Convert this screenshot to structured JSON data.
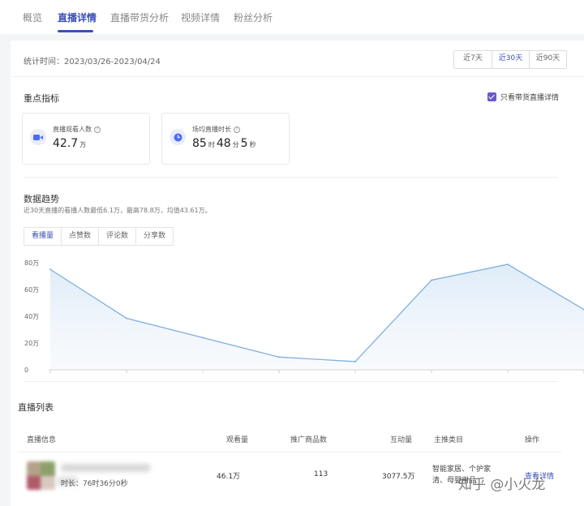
{
  "tabs": [
    {
      "label": "概览",
      "active": false
    },
    {
      "label": "直播详情",
      "active": true
    },
    {
      "label": "直播带货分析",
      "active": false
    },
    {
      "label": "视频详情",
      "active": false
    },
    {
      "label": "粉丝分析",
      "active": false
    }
  ],
  "period": "统计时间：2023/03/26-2023/04/24",
  "range_buttons": [
    {
      "label": "近7天",
      "active": false
    },
    {
      "label": "近30天",
      "active": true
    },
    {
      "label": "近90天",
      "active": false
    }
  ],
  "key_metrics": {
    "title": "重点指标",
    "checkbox_label": "只看带货直播详情",
    "checkbox_checked": true,
    "viewers": {
      "label": "直播观看人数",
      "value": "42.7",
      "unit": "万"
    },
    "duration": {
      "label": "场均直播时长",
      "h": "85",
      "h_unit": "时",
      "m": "48",
      "m_unit": "分",
      "s": "5",
      "s_unit": "秒"
    }
  },
  "trend": {
    "title": "数据趋势",
    "desc": "近30天直播的看播人数最低6.1万，最高78.8万，均值43.61万。",
    "tabs": [
      {
        "label": "看播量",
        "active": true
      },
      {
        "label": "点赞数",
        "active": false
      },
      {
        "label": "评论数",
        "active": false
      },
      {
        "label": "分享数",
        "active": false
      }
    ]
  },
  "chart_data": {
    "type": "area",
    "y_ticks": [
      "0",
      "20万",
      "40万",
      "60万",
      "80万"
    ],
    "ylim": [
      0,
      80
    ],
    "series": [
      {
        "values": [
          75,
          38.5,
          24,
          9.5,
          6.1,
          67,
          78.8,
          45
        ]
      }
    ],
    "grid": false
  },
  "live_list": {
    "title": "直播列表",
    "headers": [
      "直播信息",
      "观看量",
      "推广商品数",
      "互动量",
      "主推类目",
      "操作"
    ],
    "rows": [
      {
        "duration": "时长：76时36分0秒",
        "views": "46.1万",
        "products": "113",
        "interactions": "3077.5万",
        "categories": "智能家居、个护家清、母婴用品",
        "action": "查看详情"
      }
    ]
  },
  "watermark": "知乎 @小火龙",
  "colors": {
    "accent": "#3b4fb8",
    "checkbox": "#6a5acd",
    "chart_line": "#7fb0de"
  }
}
